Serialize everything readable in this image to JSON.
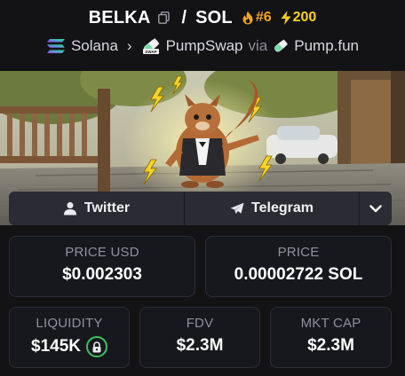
{
  "header": {
    "token_symbol": "BELKA",
    "separator": "/",
    "quote_symbol": "SOL",
    "rank": "#6",
    "boosts": "200",
    "colors": {
      "rank": "#f5a524",
      "boost": "#fcd116"
    }
  },
  "chain": {
    "network": "Solana",
    "dex": "PumpSwap",
    "via_label": "via",
    "launchpad": "Pump.fun"
  },
  "banner": {
    "icon": "squirrel-banner-image"
  },
  "links": {
    "twitter": "Twitter",
    "telegram": "Telegram"
  },
  "stats": {
    "price_usd": {
      "label": "PRICE USD",
      "value": "$0.002303"
    },
    "price_native": {
      "label": "PRICE",
      "value": "0.00002722 SOL"
    },
    "liquidity": {
      "label": "LIQUIDITY",
      "value": "$145K"
    },
    "fdv": {
      "label": "FDV",
      "value": "$2.3M"
    },
    "mkt_cap": {
      "label": "MKT CAP",
      "value": "$2.3M"
    }
  }
}
